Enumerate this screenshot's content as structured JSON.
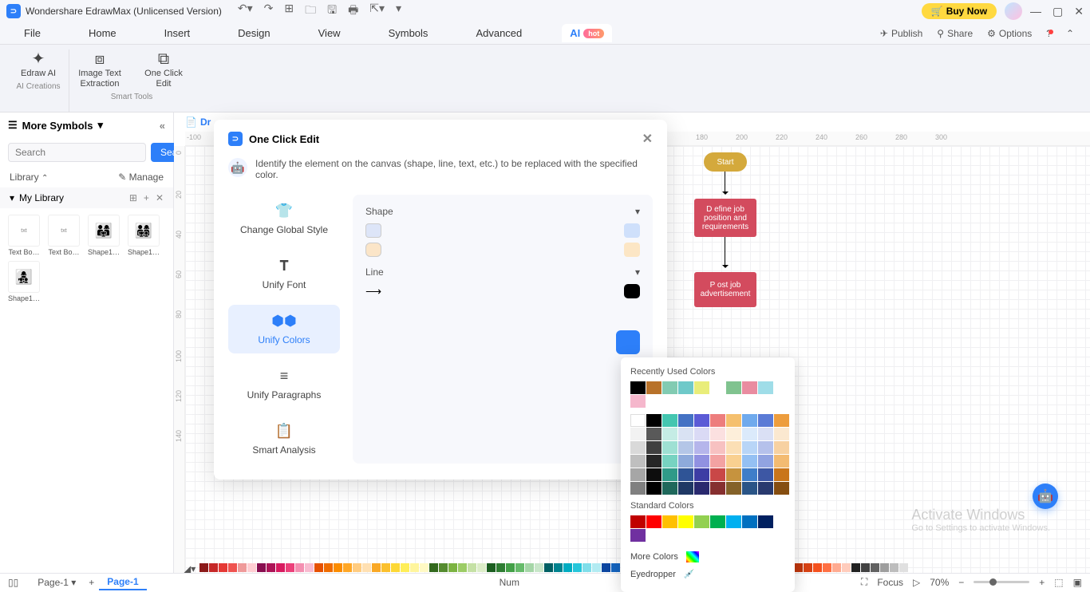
{
  "titlebar": {
    "app_title": "Wondershare EdrawMax (Unlicensed Version)",
    "buy_btn": "Buy Now"
  },
  "menubar": {
    "items": [
      "File",
      "Home",
      "Insert",
      "Design",
      "View",
      "Symbols",
      "Advanced"
    ],
    "ai": "AI",
    "hot": "hot",
    "publish": "Publish",
    "share": "Share",
    "options": "Options"
  },
  "ribbon": {
    "edraw_ai": "Edraw AI",
    "image_text": "Image Text Extraction",
    "one_click": "One Click Edit",
    "grp_creations": "AI Creations",
    "grp_smart": "Smart Tools"
  },
  "leftpanel": {
    "more_symbols": "More Symbols",
    "search_placeholder": "Search",
    "search_btn": "Search",
    "library": "Library",
    "manage": "Manage",
    "my_library": "My Library",
    "shapes": [
      "Text Bo…",
      "Text Bo…",
      "Shape1…",
      "Shape1…",
      "Shape1…"
    ]
  },
  "canvas": {
    "tab": "Dr",
    "ruler_h": [
      "-100",
      "180",
      "200",
      "220",
      "240",
      "260",
      "280",
      "300"
    ],
    "ruler_v": [
      "0",
      "20",
      "40",
      "60",
      "80",
      "100",
      "120",
      "140"
    ],
    "start": "Start",
    "node1": "D efine job position and requirements",
    "node2": "P ost job advertisement"
  },
  "dialog": {
    "title": "One Click Edit",
    "intro": "Identify the element on the canvas (shape, line, text, etc.) to be replaced with the specified color.",
    "opt1": "Change Global Style",
    "opt2": "Unify Font",
    "opt3": "Unify Colors",
    "opt4": "Unify Paragraphs",
    "opt5": "Smart Analysis",
    "shape": "Shape",
    "line": "Line"
  },
  "colorpicker": {
    "recent": "Recently Used Colors",
    "standard": "Standard Colors",
    "more": "More Colors",
    "eyedropper": "Eyedropper",
    "recent_colors": [
      "#000000",
      "#b8722a",
      "#82cbb2",
      "#6fc9c9",
      "#e9ed7a",
      "",
      "#80c38f",
      "#e98ca0",
      "#9fdde8"
    ],
    "standard_colors": [
      "#c00000",
      "#ff0000",
      "#ffc000",
      "#ffff00",
      "#92d050",
      "#00b050",
      "#00b0f0",
      "#0070c0",
      "#002060",
      "#7030a0"
    ]
  },
  "statusbar": {
    "page1_dd": "Page-1",
    "page1_tab": "Page-1",
    "num": "Num",
    "focus": "Focus",
    "zoom": "70%"
  },
  "watermark": {
    "line1": "Activate Windows",
    "line2": "Go to Settings to activate Windows."
  }
}
